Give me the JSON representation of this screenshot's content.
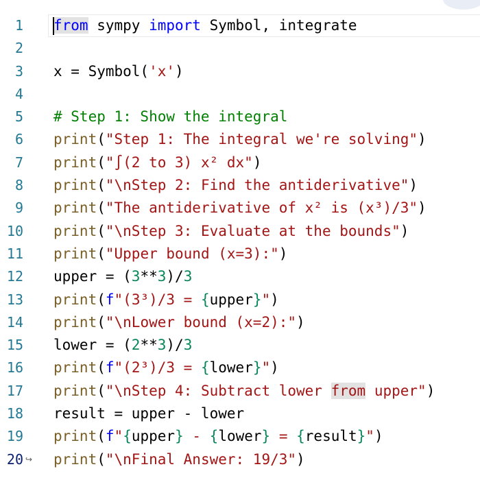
{
  "editor": {
    "lines": [
      {
        "num": "1",
        "tokens": [
          {
            "t": "from",
            "c": "kw sel"
          },
          {
            "t": " sympy ",
            "c": "pl"
          },
          {
            "t": "import",
            "c": "kw"
          },
          {
            "t": " Symbol, integrate",
            "c": "pl"
          }
        ]
      },
      {
        "num": "2",
        "tokens": []
      },
      {
        "num": "3",
        "tokens": [
          {
            "t": "x = Symbol(",
            "c": "pl"
          },
          {
            "t": "'x'",
            "c": "str"
          },
          {
            "t": ")",
            "c": "pl"
          }
        ]
      },
      {
        "num": "4",
        "tokens": []
      },
      {
        "num": "5",
        "tokens": [
          {
            "t": "# Step 1: Show the integral",
            "c": "cm"
          }
        ]
      },
      {
        "num": "6",
        "tokens": [
          {
            "t": "print",
            "c": "fn"
          },
          {
            "t": "(",
            "c": "pl"
          },
          {
            "t": "\"Step 1: The integral we're solving\"",
            "c": "str"
          },
          {
            "t": ")",
            "c": "pl"
          }
        ]
      },
      {
        "num": "7",
        "tokens": [
          {
            "t": "print",
            "c": "fn"
          },
          {
            "t": "(",
            "c": "pl"
          },
          {
            "t": "\"∫(2 to 3) x² dx\"",
            "c": "str"
          },
          {
            "t": ")",
            "c": "pl"
          }
        ]
      },
      {
        "num": "8",
        "tokens": [
          {
            "t": "print",
            "c": "fn"
          },
          {
            "t": "(",
            "c": "pl"
          },
          {
            "t": "\"\\nStep 2: Find the antiderivative\"",
            "c": "str"
          },
          {
            "t": ")",
            "c": "pl"
          }
        ]
      },
      {
        "num": "9",
        "tokens": [
          {
            "t": "print",
            "c": "fn"
          },
          {
            "t": "(",
            "c": "pl"
          },
          {
            "t": "\"The antiderivative of x² is (x³)/3\"",
            "c": "str"
          },
          {
            "t": ")",
            "c": "pl"
          }
        ]
      },
      {
        "num": "10",
        "tokens": [
          {
            "t": "print",
            "c": "fn"
          },
          {
            "t": "(",
            "c": "pl"
          },
          {
            "t": "\"\\nStep 3: Evaluate at the bounds\"",
            "c": "str"
          },
          {
            "t": ")",
            "c": "pl"
          }
        ]
      },
      {
        "num": "11",
        "tokens": [
          {
            "t": "print",
            "c": "fn"
          },
          {
            "t": "(",
            "c": "pl"
          },
          {
            "t": "\"Upper bound (x=3):\"",
            "c": "str"
          },
          {
            "t": ")",
            "c": "pl"
          }
        ]
      },
      {
        "num": "12",
        "tokens": [
          {
            "t": "upper = (",
            "c": "pl"
          },
          {
            "t": "3",
            "c": "num"
          },
          {
            "t": "**",
            "c": "pl"
          },
          {
            "t": "3",
            "c": "num"
          },
          {
            "t": ")/",
            "c": "pl"
          },
          {
            "t": "3",
            "c": "num"
          }
        ]
      },
      {
        "num": "13",
        "tokens": [
          {
            "t": "print",
            "c": "fn"
          },
          {
            "t": "(",
            "c": "pl"
          },
          {
            "t": "f",
            "c": "fi"
          },
          {
            "t": "\"(3³)/3 = ",
            "c": "str"
          },
          {
            "t": "{",
            "c": "interp"
          },
          {
            "t": "upper",
            "c": "pl"
          },
          {
            "t": "}",
            "c": "interp"
          },
          {
            "t": "\"",
            "c": "str"
          },
          {
            "t": ")",
            "c": "pl"
          }
        ]
      },
      {
        "num": "14",
        "tokens": [
          {
            "t": "print",
            "c": "fn"
          },
          {
            "t": "(",
            "c": "pl"
          },
          {
            "t": "\"\\nLower bound (x=2):\"",
            "c": "str"
          },
          {
            "t": ")",
            "c": "pl"
          }
        ]
      },
      {
        "num": "15",
        "tokens": [
          {
            "t": "lower = (",
            "c": "pl"
          },
          {
            "t": "2",
            "c": "num"
          },
          {
            "t": "**",
            "c": "pl"
          },
          {
            "t": "3",
            "c": "num"
          },
          {
            "t": ")/",
            "c": "pl"
          },
          {
            "t": "3",
            "c": "num"
          }
        ]
      },
      {
        "num": "16",
        "tokens": [
          {
            "t": "print",
            "c": "fn"
          },
          {
            "t": "(",
            "c": "pl"
          },
          {
            "t": "f",
            "c": "fi"
          },
          {
            "t": "\"(2³)/3 = ",
            "c": "str"
          },
          {
            "t": "{",
            "c": "interp"
          },
          {
            "t": "lower",
            "c": "pl"
          },
          {
            "t": "}",
            "c": "interp"
          },
          {
            "t": "\"",
            "c": "str"
          },
          {
            "t": ")",
            "c": "pl"
          }
        ]
      },
      {
        "num": "17",
        "tokens": [
          {
            "t": "print",
            "c": "fn"
          },
          {
            "t": "(",
            "c": "pl"
          },
          {
            "t": "\"\\nStep 4: Subtract lower ",
            "c": "str"
          },
          {
            "t": "from",
            "c": "str sel"
          },
          {
            "t": " upper\"",
            "c": "str"
          },
          {
            "t": ")",
            "c": "pl"
          }
        ]
      },
      {
        "num": "18",
        "tokens": [
          {
            "t": "result = upper - lower",
            "c": "pl"
          }
        ]
      },
      {
        "num": "19",
        "tokens": [
          {
            "t": "print",
            "c": "fn"
          },
          {
            "t": "(",
            "c": "pl"
          },
          {
            "t": "f",
            "c": "fi"
          },
          {
            "t": "\"",
            "c": "str"
          },
          {
            "t": "{",
            "c": "interp"
          },
          {
            "t": "upper",
            "c": "pl"
          },
          {
            "t": "}",
            "c": "interp"
          },
          {
            "t": " - ",
            "c": "str"
          },
          {
            "t": "{",
            "c": "interp"
          },
          {
            "t": "lower",
            "c": "pl"
          },
          {
            "t": "}",
            "c": "interp"
          },
          {
            "t": " = ",
            "c": "str"
          },
          {
            "t": "{",
            "c": "interp"
          },
          {
            "t": "result",
            "c": "pl"
          },
          {
            "t": "}",
            "c": "interp"
          },
          {
            "t": "\"",
            "c": "str"
          },
          {
            "t": ")",
            "c": "pl"
          }
        ]
      },
      {
        "num": "20",
        "wrap": true,
        "tokens": [
          {
            "t": "print",
            "c": "fn"
          },
          {
            "t": "(",
            "c": "pl"
          },
          {
            "t": "\"\\nFinal Answer: 19/3\"",
            "c": "str"
          },
          {
            "t": ")",
            "c": "pl"
          }
        ]
      }
    ],
    "wrap_icon": "wrap-arrow-icon",
    "wrap_glyph": "↪"
  }
}
